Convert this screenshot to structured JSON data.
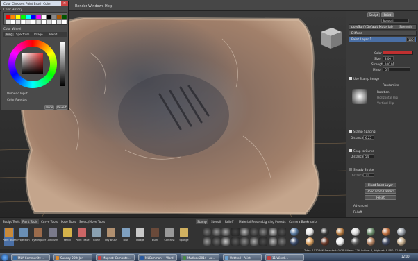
{
  "menu": {
    "items": [
      "Render",
      "Windows",
      "Help"
    ],
    "partial_title": "ommunity"
  },
  "color_chooser": {
    "title": "Color Chooser: Paint Brush Color",
    "sections": {
      "history": "Color History",
      "wheel": "Color Wheel",
      "numeric": "Numeric Input",
      "palettes": "Color Palettes"
    },
    "tabs": [
      "Ring",
      "Spectrum",
      "Image",
      "Blend"
    ],
    "buttons": {
      "done": "Done",
      "revert": "Revert"
    },
    "palette_colors": [
      "#ff0000",
      "#ff8800",
      "#ffff00",
      "#00ff00",
      "#00ffff",
      "#0000ff",
      "#ff00ff",
      "#ffffff",
      "#000000",
      "#888888",
      "#aa5500",
      "#005500"
    ]
  },
  "right_panel": {
    "top_tabs": [
      "Sculpt",
      "Paint"
    ],
    "normal_label": "Normal",
    "material_label": "polySurf (Default Material)",
    "strength_label": "Strength",
    "diffuse_label": "Diffuse",
    "layer_name": "Paint Layer 1",
    "layer_value": "100",
    "color_label": "Color",
    "size": {
      "label": "Size",
      "value": "3.00"
    },
    "strength": {
      "label": "Strength",
      "value": "100.00"
    },
    "mirror": {
      "label": "Mirror",
      "value": "Off"
    },
    "use_stamp": "Use Stamp Image",
    "randomize": "Randomize",
    "rotation": "Rotation",
    "horizontal_flip": "Horizontal Flip",
    "vertical_flip": "Vertical Flip",
    "stamp_spacing": {
      "label": "Stamp Spacing",
      "dist_label": "Distance",
      "value": "6.25"
    },
    "snap_to_curve": {
      "label": "Snap to Curve",
      "dist_label": "Distance",
      "value": "54"
    },
    "steady_stroke": {
      "label": "Steady Stroke",
      "dist_label": "Distance",
      "value": "20"
    },
    "buttons": [
      "Flood Paint Layer",
      "Flood From Camera",
      "Reset"
    ],
    "advanced": "Advanced",
    "falloff": "Falloff"
  },
  "bottom": {
    "tool_tabs": [
      "Sculpt Tools",
      "Paint Tools",
      "Curve Tools",
      "Pose Tools",
      "Select/Move Tools"
    ],
    "tools": [
      "Paint Brush",
      "Projection",
      "Eyedropper",
      "Airbrush",
      "Pencil",
      "Paint Erase",
      "Clone",
      "Dry Brush",
      "Blur",
      "Dodge",
      "Burn",
      "Contrast",
      "Sponge"
    ],
    "tool_colors": [
      "#c98a3a",
      "#6a8fb5",
      "#9b6b4b",
      "#7a7a8a",
      "#d4b24a",
      "#cc6666",
      "#8aa0b0",
      "#b09070",
      "#7fa0c0",
      "#c8c8c8",
      "#6a4a3a",
      "#999999",
      "#d0b060"
    ],
    "stamp_tabs": [
      "Stamp",
      "Stencil",
      "Falloff",
      "Material Presets",
      "Lighting Presets",
      "Camera Bookmarks"
    ],
    "stamp_thumbs": [
      "#777",
      "#999",
      "#aaa",
      "#444",
      "#bbb",
      "#666",
      "#888",
      "#ccc",
      "#555",
      "#a0a0a0",
      "#707070",
      "#d0d0d0",
      "#606060",
      "#909090",
      "#b0b0b0",
      "#505050",
      "#c0c0c0",
      "#808080"
    ],
    "material_thumbs": [
      "#5a7aa0",
      "#e8e8e8",
      "#3a3a3a",
      "#b57a40",
      "#d8d8d8",
      "#6a8a6a",
      "#c07040",
      "#9aa0a8",
      "#3a4a6a",
      "#d9a060",
      "#6a3a2a",
      "#f0f0f0",
      "#5a5a5a",
      "#b08060",
      "#404860",
      "#c8b090"
    ]
  },
  "status": {
    "text": "Total: 157286K Selected: 0  GPU Mem: 73K  Active: 8, Highest: 8  FPS: 52.9914"
  },
  "taskbar": {
    "tasks": [
      "MLA Community ...",
      "Sunday 26th Jan",
      "Magnet: Compute...",
      "MLCommon — Word",
      "Mudbox 2014 - Au...",
      "Untitled - Paint",
      "11 Wired ..."
    ],
    "task_colors": [
      "#3a6ea5",
      "#e08a2a",
      "#d04040",
      "#2a5aa0",
      "#4a8a4a",
      "#6aa0d0",
      "#c04040"
    ],
    "time": "12:00"
  }
}
